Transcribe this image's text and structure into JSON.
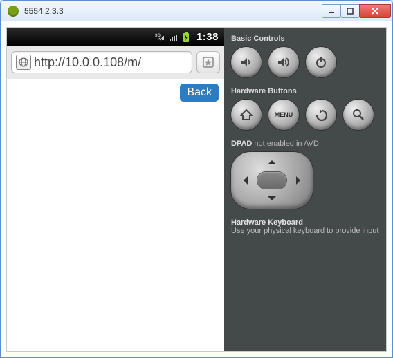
{
  "window": {
    "title": "5554:2.3.3"
  },
  "statusbar": {
    "time": "1:38"
  },
  "urlbar": {
    "url": "http://10.0.0.108/m/"
  },
  "webview": {
    "back_label": "Back"
  },
  "panel": {
    "basic_label": "Basic Controls",
    "hw_buttons_label": "Hardware Buttons",
    "menu_label": "MENU",
    "dpad_label_prefix": "DPAD",
    "dpad_label_suffix": " not enabled in AVD",
    "kbd_label": "Hardware Keyboard",
    "kbd_sub": "Use your physical keyboard to provide input"
  }
}
